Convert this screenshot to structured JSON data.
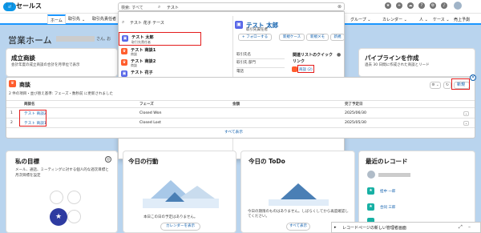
{
  "topbar": {
    "logo_label": "sf",
    "search_scope": "検索: すべて",
    "search_query": "テスト",
    "right_icons": [
      "plus-icon",
      "help-icon",
      "gear-icon",
      "bell-icon",
      "avatar"
    ]
  },
  "navbar": {
    "app_name": "セールス",
    "tabs": [
      "ホーム",
      "取引先",
      "取引先責任者"
    ],
    "right_items": [
      "グループ ⌄",
      "カレンダー ⌄",
      "人 ⌄",
      "ケース ⌄",
      "売上予測"
    ]
  },
  "page": {
    "title": "営業ホーム",
    "greeting_suffix": "さん, お"
  },
  "cards": {
    "ktitle": "成立商談",
    "ksub": "会計年度の成立商談の合計を月単位で表示",
    "pipeline_title": "パイプラインを作成",
    "pipeline_sub": "過去 30 日間に作成された商談とリード",
    "goals_title": "私の目標",
    "goals_desc": "メール、通話、ミーティングに対する個人的な週次目標と月次目標を設定",
    "events_title": "今日の行動",
    "events_msg": "本日この日の予定はありません。",
    "events_btn": "カレンダーを表示",
    "todo_title": "今日の ToDo",
    "todo_msg": "今日の期限のものはありません。しばらくしてから再度確認してください。",
    "todo_btn": "すべて表示",
    "recent_title": "最近のレコード",
    "recent_items": [
      "",
      "担中 一郎",
      "合同 三郎",
      "北 一郎"
    ]
  },
  "dropdown": {
    "header": "テスト 花子 テース",
    "items": [
      {
        "t1": "テスト 太郎",
        "t2": "取引先責任者",
        "color": "#5867e8",
        "icon": "contact-icon"
      },
      {
        "t1": "テスト 商談1",
        "t2": "商談",
        "color": "#ff5d2d",
        "icon": "opportunity-icon"
      },
      {
        "t1": "テスト 商談2",
        "t2": "商談",
        "color": "#ff5d2d",
        "icon": "opportunity-icon"
      },
      {
        "t1": "テスト 花子",
        "t2": "",
        "color": "#5867e8",
        "icon": "contact-icon"
      }
    ]
  },
  "preview": {
    "name": "テスト 太郎",
    "subtitle": "取引先責任者",
    "follow_btn": "+ フォローする",
    "btn_case": "新規ケース",
    "btn_note": "新規メモ",
    "btn_more": "新規",
    "fields": [
      "取引先名",
      "取引先 部門",
      "電話"
    ],
    "related_title": "関連リストのクイックリンク",
    "related_link": "商談 (2)"
  },
  "related_list": {
    "title": "商談",
    "subtitle": "2 件の項目・並び替え基準: フェーズ・数秒前 に更新されました",
    "new_btn": "新規",
    "columns": [
      "商談名",
      "フェーズ",
      "金額",
      "完了予定日"
    ],
    "rows": [
      {
        "n": "1",
        "name": "テスト 商談2",
        "phase": "Closed Won",
        "amount": "",
        "date": "2025/06/30"
      },
      {
        "n": "2",
        "name": "テスト 商談1",
        "phase": "Closed Lost",
        "amount": "",
        "date": "2025/05/30"
      }
    ],
    "show_all": "すべて表示"
  },
  "toast": {
    "text": "レコードページの新しい管理者画面"
  },
  "colors": {
    "accent": "#1b96ff",
    "red": "#e31c1c",
    "link": "#0b5cab"
  }
}
